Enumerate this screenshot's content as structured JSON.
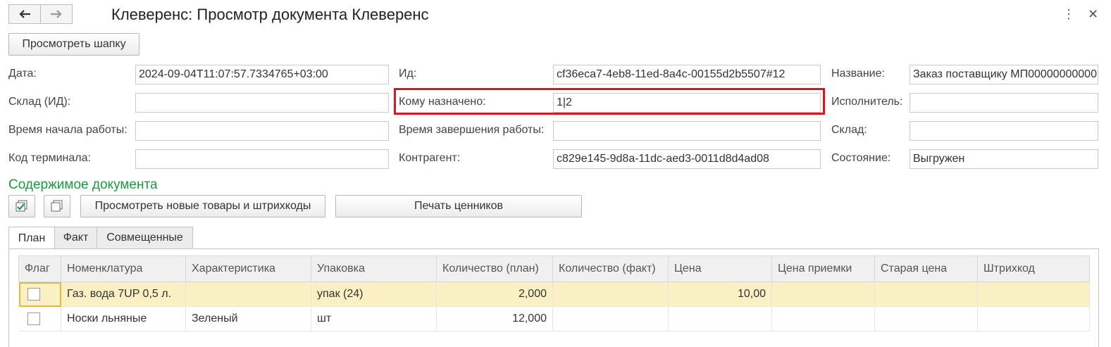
{
  "window": {
    "title": "Клеверенс: Просмотр документа Клеверенс"
  },
  "header_button": "Просмотреть шапку",
  "fields": {
    "date": {
      "label": "Дата:",
      "value": "2024-09-04T11:07:57.7334765+03:00"
    },
    "id": {
      "label": "Ид:",
      "value": "cf36eca7-4eb8-11ed-8a4c-00155d2b5507#12"
    },
    "name": {
      "label": "Название:",
      "value": "Заказ поставщику МП00000000000"
    },
    "warehouse_id": {
      "label": "Склад (ИД):",
      "value": ""
    },
    "assigned_to": {
      "label": "Кому назначено:",
      "value": "1|2"
    },
    "executor": {
      "label": "Исполнитель:",
      "value": ""
    },
    "start_time": {
      "label": "Время начала работы:",
      "value": ""
    },
    "end_time": {
      "label": "Время завершения работы:",
      "value": ""
    },
    "warehouse": {
      "label": "Склад:",
      "value": ""
    },
    "terminal_code": {
      "label": "Код терминала:",
      "value": ""
    },
    "counterparty": {
      "label": "Контрагент:",
      "value": "c829e145-9d8a-11dc-aed3-0011d8d4ad08"
    },
    "state": {
      "label": "Состояние:",
      "value": "Выгружен"
    }
  },
  "section_title": "Содержимое документа",
  "toolbar": {
    "view_new_goods": "Просмотреть новые товары и штрихкоды",
    "print_price_tags": "Печать ценников"
  },
  "tabs": [
    "План",
    "Факт",
    "Совмещенные"
  ],
  "table": {
    "columns": [
      "Флаг",
      "Номенклатура",
      "Характеристика",
      "Упаковка",
      "Количество (план)",
      "Количество (факт)",
      "Цена",
      "Цена приемки",
      "Старая цена",
      "Штрихкод"
    ],
    "rows": [
      {
        "flag": false,
        "item": "Газ. вода 7UP 0,5 л.",
        "characteristic": "",
        "package": "упак (24)",
        "qty_plan": "2,000",
        "qty_fact": "",
        "price": "10,00",
        "receipt_price": "",
        "old_price": "",
        "barcode": ""
      },
      {
        "flag": false,
        "item": "Носки льняные",
        "characteristic": "Зеленый",
        "package": "шт",
        "qty_plan": "12,000",
        "qty_fact": "",
        "price": "",
        "receipt_price": "",
        "old_price": "",
        "barcode": ""
      }
    ]
  },
  "colors": {
    "section": "#1a9a3e",
    "highlight": "#e0141e",
    "selected_row": "#fbf0c3"
  }
}
